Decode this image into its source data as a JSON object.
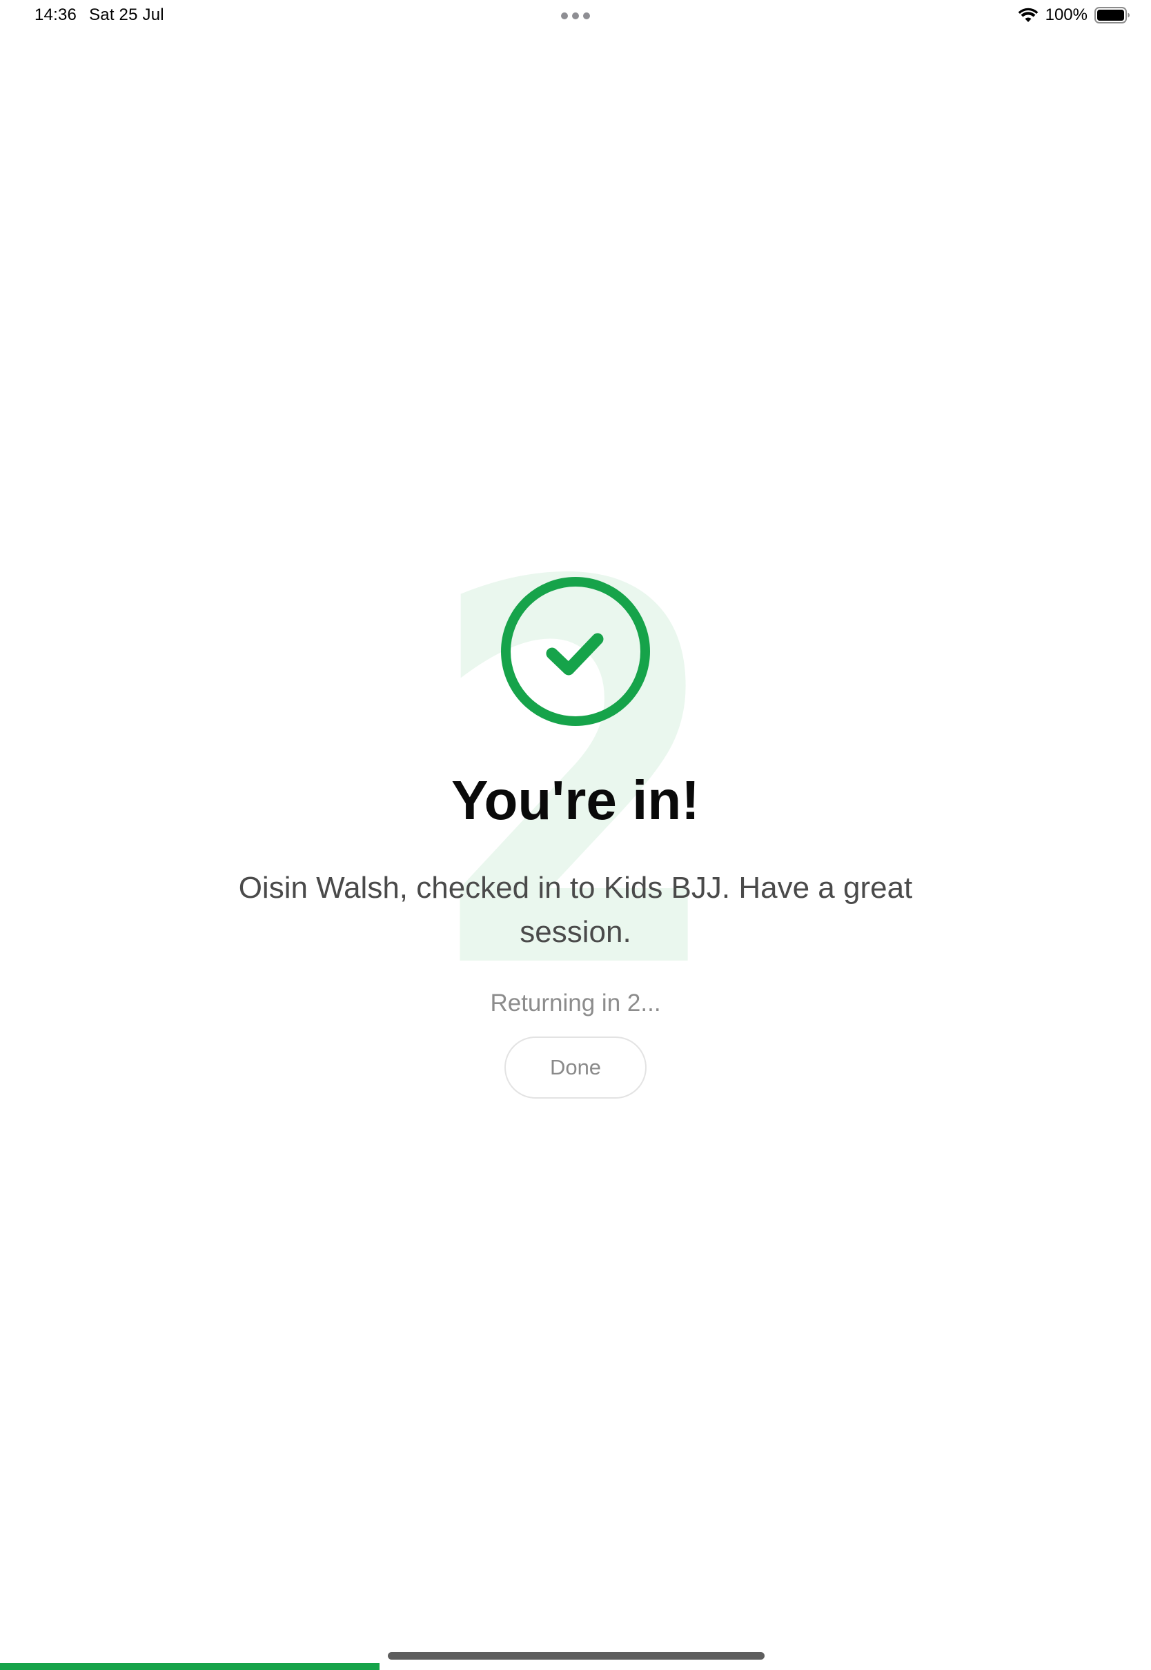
{
  "status_bar": {
    "time": "14:36",
    "date": "Sat 25 Jul",
    "battery_percent": "100%",
    "wifi_icon": "wifi-icon",
    "battery_icon": "battery-full-icon"
  },
  "success": {
    "icon": "check-circle-icon",
    "headline": "You're in!",
    "message": "Oisin Walsh, checked in to Kids BJJ. Have a great session.",
    "countdown_number": "2",
    "returning_text": "Returning in 2...",
    "done_label": "Done"
  },
  "progress": {
    "fraction": 0.33
  },
  "colors": {
    "accent": "#16a34a",
    "watermark": "#eaf7ee",
    "headline": "#0a0a0a",
    "message": "#4a4a4a",
    "muted": "#8c8c8c"
  }
}
